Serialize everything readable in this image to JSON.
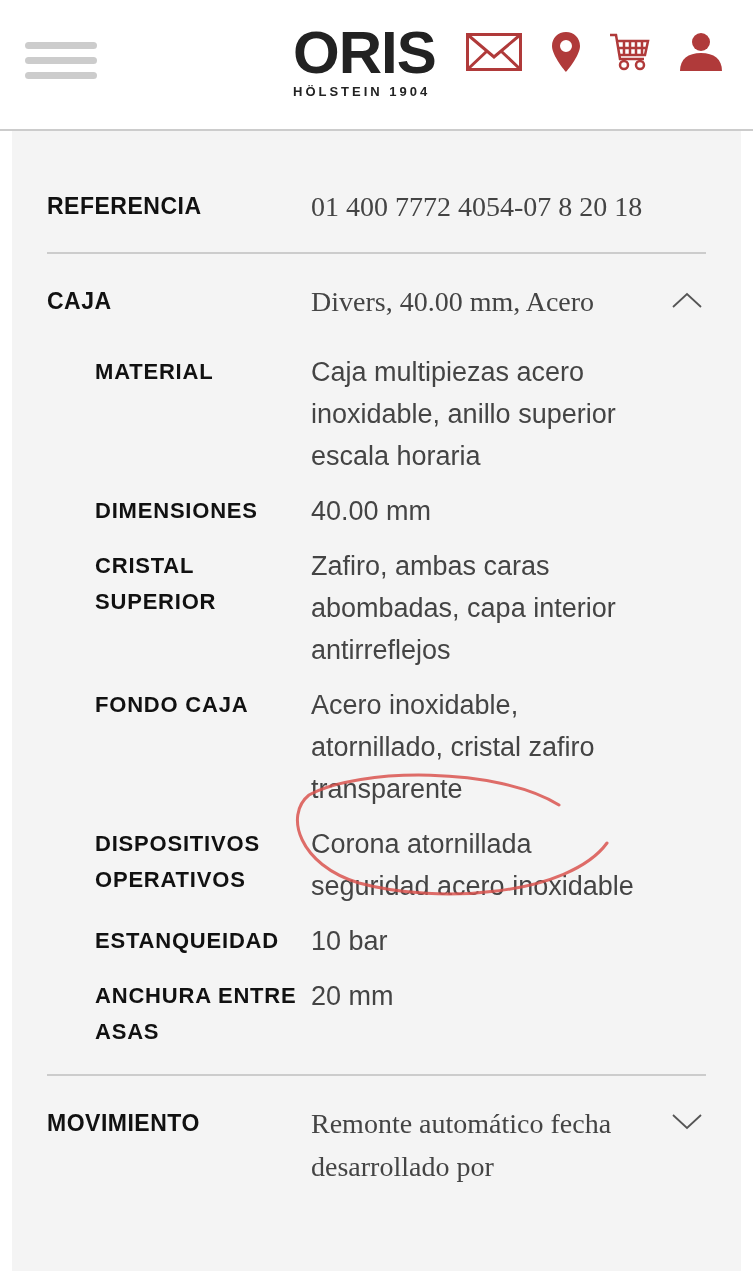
{
  "header": {
    "logo": "ORIS",
    "tagline": "HÖLSTEIN 1904"
  },
  "sections": [
    {
      "label": "REFERENCIA",
      "summary": "01 400 7772 4054-07 8 20 18"
    },
    {
      "label": "CAJA",
      "summary": "Divers, 40.00 mm, Acero",
      "expanded": true,
      "specs": [
        {
          "label": "MATERIAL",
          "value": "Caja multipiezas acero inoxidable, anillo superior escala horaria",
          "highlighted": false
        },
        {
          "label": "DIMENSIONES",
          "value": "40.00 mm",
          "highlighted": false
        },
        {
          "label": "CRISTAL SUPERIOR",
          "value": "Zafiro, ambas caras abombadas, capa interior antirreflejos",
          "highlighted": false
        },
        {
          "label": "FONDO CAJA",
          "value": "Acero inoxidable, atornillado, cristal zafiro transparente",
          "highlighted": false
        },
        {
          "label": "DISPOSITIVOS OPERATIVOS",
          "value": "Corona atornillada seguridad acero inoxidable",
          "highlighted": true
        },
        {
          "label": "ESTANQUEIDAD",
          "value": "10 bar",
          "highlighted": false
        },
        {
          "label": "ANCHURA ENTRE ASAS",
          "value": "20 mm",
          "highlighted": false
        }
      ]
    },
    {
      "label": "MOVIMIENTO",
      "summary": "Remonte automático fecha desarrollado por",
      "expanded": false
    }
  ]
}
